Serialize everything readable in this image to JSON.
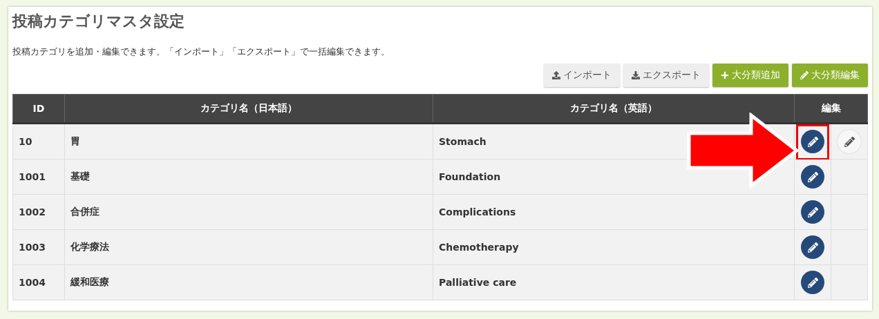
{
  "page": {
    "title": "投稿カテゴリマスタ設定",
    "description": "投稿カテゴリを追加・編集できます。「インポート」「エクスポート」で一括編集できます。"
  },
  "toolbar": [
    {
      "kind": "import",
      "label": "インポート"
    },
    {
      "kind": "export",
      "label": "エクスポート"
    },
    {
      "kind": "add",
      "label": "大分類追加"
    },
    {
      "kind": "edit",
      "label": "大分類編集"
    }
  ],
  "table": {
    "columns": [
      "ID",
      "カテゴリ名（日本語）",
      "カテゴリ名（英語）",
      "編集"
    ],
    "rows": [
      {
        "id": "10",
        "name_ja": "胃",
        "name_en": "Stomach",
        "sub_edit": true,
        "highlighted": true
      },
      {
        "id": "1001",
        "name_ja": "基礎",
        "name_en": "Foundation",
        "sub_edit": false,
        "highlighted": false
      },
      {
        "id": "1002",
        "name_ja": "合併症",
        "name_en": "Complications",
        "sub_edit": false,
        "highlighted": false
      },
      {
        "id": "1003",
        "name_ja": "化学療法",
        "name_en": "Chemotherapy",
        "sub_edit": false,
        "highlighted": false
      },
      {
        "id": "1004",
        "name_ja": "緩和医療",
        "name_en": "Palliative care",
        "sub_edit": false,
        "highlighted": false
      }
    ]
  }
}
